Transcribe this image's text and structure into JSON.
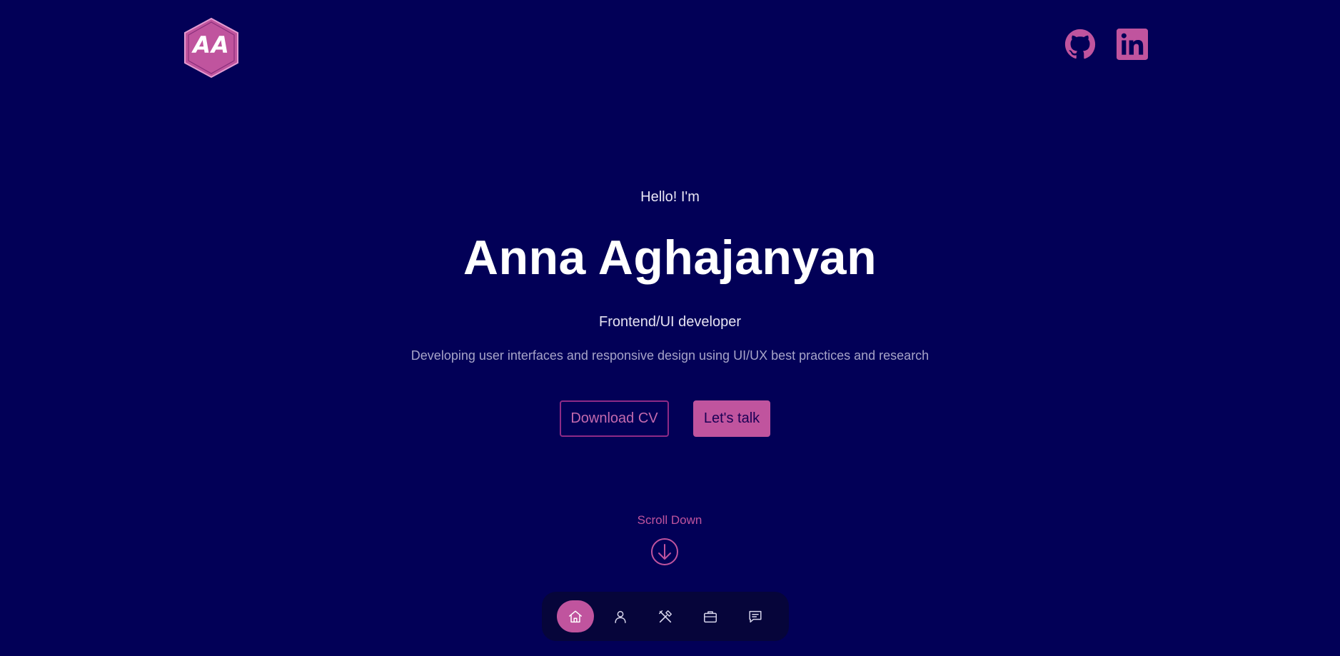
{
  "header": {
    "logo_text": "AA",
    "logo_icon": "hexagon-monogram-logo",
    "social": [
      {
        "name": "github-icon"
      },
      {
        "name": "linkedin-icon"
      }
    ]
  },
  "hero": {
    "greeting": "Hello! I'm",
    "name": "Anna Aghajanyan",
    "role": "Frontend/UI developer",
    "tagline": "Developing user interfaces and responsive design using UI/UX best practices and research",
    "download_label": "Download CV",
    "talk_label": "Let's talk"
  },
  "scroll": {
    "label": "Scroll Down",
    "icon": "arrow-down-circle-icon"
  },
  "dock": {
    "items": [
      {
        "icon": "home-icon",
        "active": true
      },
      {
        "icon": "user-icon",
        "active": false
      },
      {
        "icon": "tools-icon",
        "active": false
      },
      {
        "icon": "briefcase-icon",
        "active": false
      },
      {
        "icon": "message-icon",
        "active": false
      }
    ]
  },
  "colors": {
    "background": "#020057",
    "accent": "#c0549e",
    "dock": "#06053a",
    "text": "#ffffff",
    "muted": "#a7a4c8"
  }
}
